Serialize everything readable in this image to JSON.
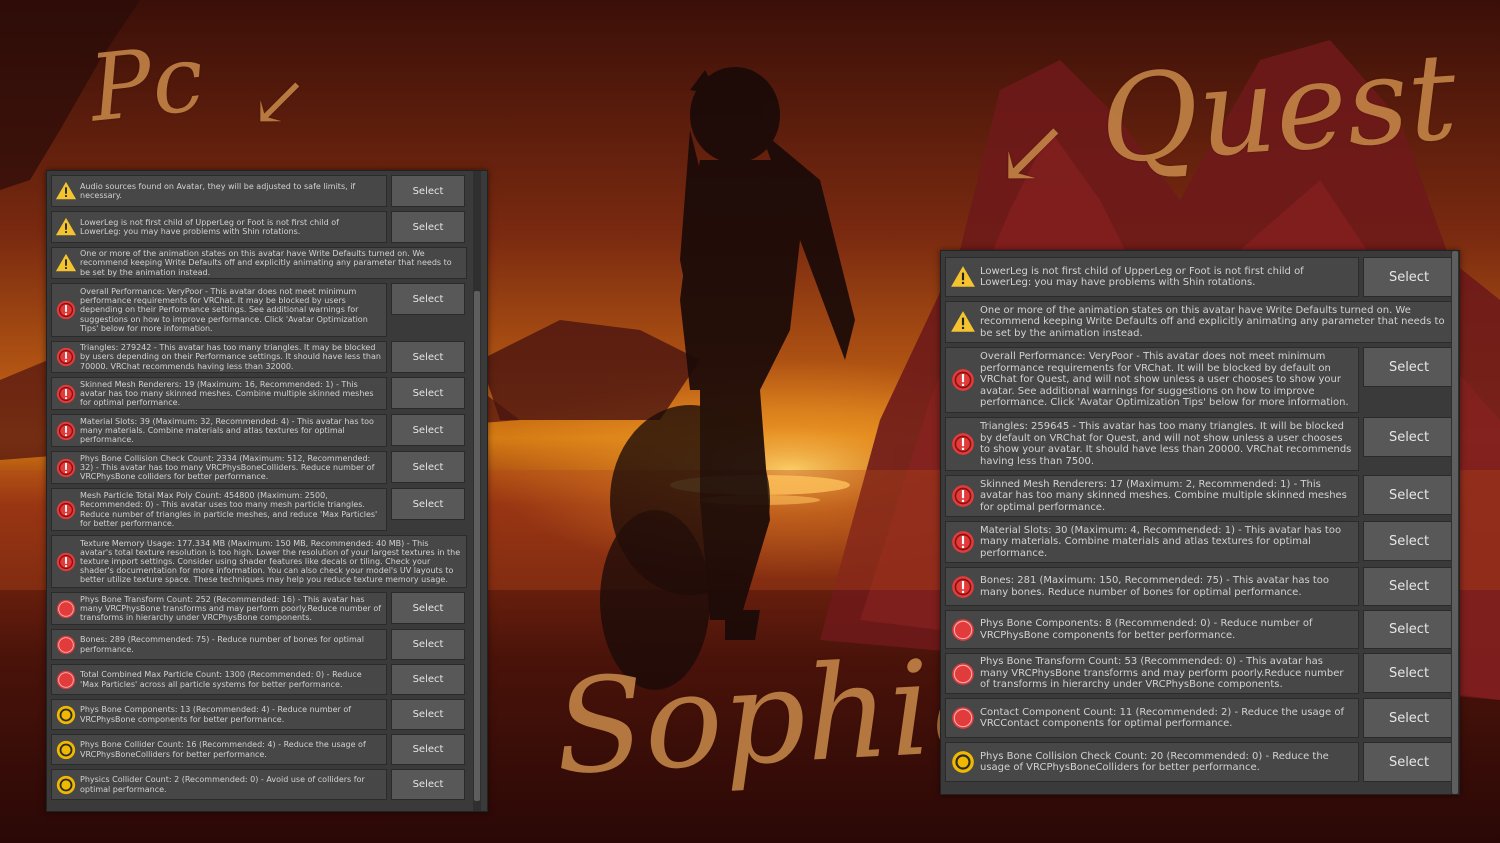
{
  "colors": {
    "warning": "#f4c430",
    "error": "#e23b3b",
    "info": "#f0b800",
    "panel": "#3a3a3a",
    "row": "#474747",
    "button": "#585858"
  },
  "overlay": {
    "left_heading": "Pc",
    "right_heading": "Quest",
    "avatar_name": "Sophie"
  },
  "pc_panel": {
    "items": [
      {
        "icon": "warning-icon",
        "text": "Audio sources found on Avatar, they will be adjusted to safe limits, if necessary.",
        "button": "Select"
      },
      {
        "icon": "warning-icon",
        "text": "LowerLeg is not first child of UpperLeg or Foot is not first child of LowerLeg: you may have problems with Shin rotations.",
        "button": "Select"
      },
      {
        "icon": "warning-icon",
        "text": "One or more of the animation states on this avatar have Write Defaults turned on. We recommend keeping Write Defaults off and explicitly animating any parameter that needs to be set by the animation instead.",
        "button": ""
      },
      {
        "icon": "error-icon",
        "text": "Overall Performance: VeryPoor - This avatar does not meet minimum performance requirements for VRChat. It may be blocked by users depending on their Performance settings. See additional warnings for suggestions on how to improve performance. Click 'Avatar Optimization Tips' below for more information.",
        "button": "Select"
      },
      {
        "icon": "error-icon",
        "text": "Triangles: 279242 - This avatar has too many triangles. It may be blocked by users depending on their Performance settings. It should have less than 70000. VRChat recommends having less than 32000.",
        "button": "Select"
      },
      {
        "icon": "error-icon",
        "text": "Skinned Mesh Renderers: 19 (Maximum: 16, Recommended: 1) - This avatar has too many skinned meshes. Combine multiple skinned meshes for optimal performance.",
        "button": "Select"
      },
      {
        "icon": "error-icon",
        "text": "Material Slots: 39 (Maximum: 32, Recommended: 4) - This avatar has too many materials. Combine materials and atlas textures for optimal performance.",
        "button": "Select"
      },
      {
        "icon": "error-icon",
        "text": "Phys Bone Collision Check Count: 2334 (Maximum: 512, Recommended: 32) - This avatar has too many VRCPhysBoneColliders. Reduce number of VRCPhysBone colliders for better performance.",
        "button": "Select"
      },
      {
        "icon": "error-icon",
        "text": "Mesh Particle Total Max Poly Count: 454800 (Maximum: 2500, Recommended: 0) - This avatar uses too many mesh particle triangles. Reduce number of triangles in particle meshes, and reduce 'Max Particles' for better performance.",
        "button": "Select"
      },
      {
        "icon": "error-icon",
        "text": "Texture Memory Usage: 177.334 MB (Maximum: 150 MB, Recommended: 40 MB) - This avatar's total texture resolution is too high. Lower the resolution of your largest textures in the texture import settings. Consider using shader features like decals or tiling. Check your shader's documentation for more information. You can also check your model's UV layouts to better utilize texture space. These techniques may help you reduce texture memory usage.",
        "button": ""
      },
      {
        "icon": "stop-icon",
        "text": "Phys Bone Transform Count: 252 (Recommended: 16) - This avatar has many VRCPhysBone transforms and may perform poorly.Reduce number of transforms in hierarchy under VRCPhysBone components.",
        "button": "Select"
      },
      {
        "icon": "stop-icon",
        "text": "Bones: 289 (Recommended: 75) - Reduce number of bones for optimal performance.",
        "button": "Select"
      },
      {
        "icon": "stop-icon",
        "text": "Total Combined Max Particle Count: 1300 (Recommended: 0) - Reduce 'Max Particles' across all particle systems for better performance.",
        "button": "Select"
      },
      {
        "icon": "info-ring-icon",
        "text": "Phys Bone Components: 13 (Recommended: 4) - Reduce number of VRCPhysBone components for better performance.",
        "button": "Select"
      },
      {
        "icon": "info-ring-icon",
        "text": "Phys Bone Collider Count: 16 (Recommended: 4) - Reduce the usage of VRCPhysBoneColliders for better performance.",
        "button": "Select"
      },
      {
        "icon": "info-ring-icon",
        "text": "Physics Collider Count: 2 (Recommended: 0) - Avoid use of colliders for optimal performance.",
        "button": "Select"
      }
    ]
  },
  "quest_panel": {
    "items": [
      {
        "icon": "warning-icon",
        "text": "LowerLeg is not first child of UpperLeg or Foot is not first child of LowerLeg: you may have problems with Shin rotations.",
        "button": "Select"
      },
      {
        "icon": "warning-icon",
        "text": "One or more of the animation states on this avatar have Write Defaults turned on. We recommend keeping Write Defaults off and explicitly animating any parameter that needs to be set by the animation instead.",
        "button": ""
      },
      {
        "icon": "error-icon",
        "text": "Overall Performance: VeryPoor - This avatar does not meet minimum performance requirements for VRChat. It will be blocked by default on VRChat for Quest, and will not show unless a user chooses to show your avatar. See additional warnings for suggestions on how to improve performance. Click 'Avatar Optimization Tips' below for more information.",
        "button": "Select"
      },
      {
        "icon": "error-icon",
        "text": "Triangles: 259645 - This avatar has too many triangles. It will be blocked by default on VRChat for Quest, and will not show unless a user chooses to show your avatar. It should have less than 20000. VRChat recommends having less than 7500.",
        "button": "Select"
      },
      {
        "icon": "error-icon",
        "text": "Skinned Mesh Renderers: 17 (Maximum: 2, Recommended: 1) - This avatar has too many skinned meshes. Combine multiple skinned meshes for optimal performance.",
        "button": "Select"
      },
      {
        "icon": "error-icon",
        "text": "Material Slots: 30 (Maximum: 4, Recommended: 1) - This avatar has too many materials. Combine materials and atlas textures for optimal performance.",
        "button": "Select"
      },
      {
        "icon": "error-icon",
        "text": "Bones: 281 (Maximum: 150, Recommended: 75) - This avatar has too many bones. Reduce number of bones for optimal performance.",
        "button": "Select"
      },
      {
        "icon": "stop-icon",
        "text": "Phys Bone Components: 8 (Recommended: 0) - Reduce number of VRCPhysBone components for better performance.",
        "button": "Select"
      },
      {
        "icon": "stop-icon",
        "text": "Phys Bone Transform Count: 53 (Recommended: 0) - This avatar has many VRCPhysBone transforms and may perform poorly.Reduce number of transforms in hierarchy under VRCPhysBone components.",
        "button": "Select"
      },
      {
        "icon": "stop-icon",
        "text": "Contact Component Count: 11 (Recommended: 2) - Reduce the usage of VRCContact components for optimal performance.",
        "button": "Select"
      },
      {
        "icon": "info-ring-icon",
        "text": "Phys Bone Collision Check Count: 20 (Recommended: 0) - Reduce the usage of VRCPhysBoneColliders for better performance.",
        "button": "Select"
      }
    ]
  }
}
